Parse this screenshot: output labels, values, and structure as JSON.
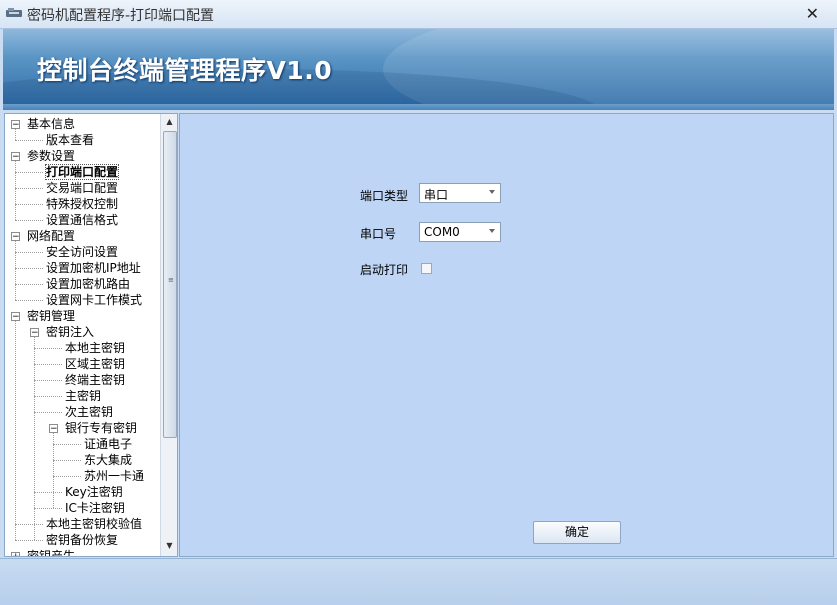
{
  "window": {
    "title": "密码机配置程序-打印端口配置",
    "close_glyph": "✕"
  },
  "banner": {
    "heading": "控制台终端管理程序V1.0"
  },
  "tree": {
    "nodes": [
      {
        "label": "基本信息",
        "toggle": "−"
      },
      {
        "label": "版本查看"
      },
      {
        "label": "参数设置",
        "toggle": "−"
      },
      {
        "label": "打印端口配置",
        "selected": true
      },
      {
        "label": "交易端口配置"
      },
      {
        "label": "特殊授权控制"
      },
      {
        "label": "设置通信格式"
      },
      {
        "label": "网络配置",
        "toggle": "−"
      },
      {
        "label": "安全访问设置"
      },
      {
        "label": "设置加密机IP地址"
      },
      {
        "label": "设置加密机路由"
      },
      {
        "label": "设置网卡工作模式"
      },
      {
        "label": "密钥管理",
        "toggle": "−"
      },
      {
        "label": "密钥注入",
        "toggle": "−"
      },
      {
        "label": "本地主密钥"
      },
      {
        "label": "区域主密钥"
      },
      {
        "label": "终端主密钥"
      },
      {
        "label": "主密钥"
      },
      {
        "label": "次主密钥"
      },
      {
        "label": "银行专有密钥",
        "toggle": "−"
      },
      {
        "label": "证通电子"
      },
      {
        "label": "东大集成"
      },
      {
        "label": "苏州一卡通"
      },
      {
        "label": "Key注密钥"
      },
      {
        "label": "IC卡注密钥"
      },
      {
        "label": "本地主密钥校验值"
      },
      {
        "label": "密钥备份恢复"
      },
      {
        "label": "密钥产生",
        "toggle": "+"
      }
    ],
    "scroll_up": "▲",
    "scroll_down": "▼",
    "grip": "≡"
  },
  "form": {
    "port_type_label": "端口类型",
    "port_type_value": "串口",
    "serial_no_label": "串口号",
    "serial_no_value": "COM0",
    "enable_print_label": "启动打印",
    "enable_print_checked": false,
    "ok_label": "确定"
  },
  "colors": {
    "content_bg": "#bed5f5",
    "banner_accent": "#2d6aa5"
  }
}
